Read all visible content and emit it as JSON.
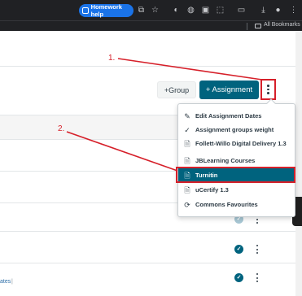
{
  "browser": {
    "homework_help_label": "Homework help",
    "all_bookmarks_label": "All Bookmarks"
  },
  "toolbar": {
    "group_button_label": "+Group",
    "assignment_button_label": "+ Assignment"
  },
  "annotations": {
    "step_1": "1.",
    "step_2": "2."
  },
  "menu": {
    "items": [
      {
        "label": "Edit Assignment Dates",
        "icon": "pencil-icon"
      },
      {
        "label": "Assignment groups weight",
        "icon": "checkmark-icon"
      },
      {
        "label": "Follett-Willo Digital Delivery 1.3",
        "icon": "document-icon"
      },
      {
        "label": "JBLearning Courses",
        "icon": "document-icon"
      },
      {
        "label": "Turnitin",
        "icon": "document-icon",
        "active": true
      },
      {
        "label": "uCertify 1.3",
        "icon": "document-icon"
      },
      {
        "label": "Commons Favourites",
        "icon": "commons-icon"
      }
    ]
  },
  "page": {
    "fragment_text": "ates"
  },
  "colors": {
    "accent": "#00637e",
    "annotation_red": "#d6202a"
  }
}
